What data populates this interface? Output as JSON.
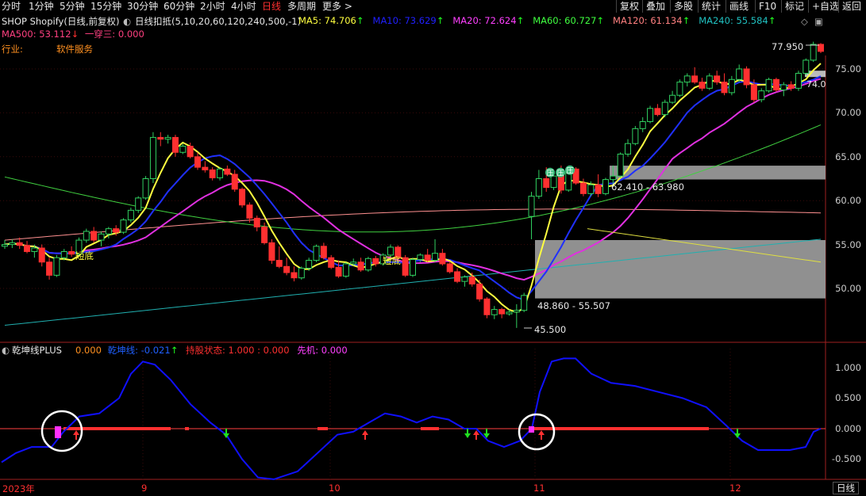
{
  "toolbar": {
    "periods": [
      "分时",
      "1分钟",
      "5分钟",
      "15分钟",
      "30分钟",
      "60分钟",
      "2小时",
      "4小时",
      "日线",
      "多周期",
      "更多 >"
    ],
    "active_period": "日线",
    "right_buttons": [
      "复权",
      "叠加",
      "多股",
      "统计",
      "画线",
      "F10",
      "标记",
      "+自选",
      "返回"
    ]
  },
  "header": {
    "stock": "SHOP Shopify(日线,前复权)",
    "indicator_name": "日线扣抵(5,10,20,60,120,240,500,-1)",
    "ma_values": [
      {
        "label": "MA5: 74.706",
        "arrow": "↑",
        "color": "#ffff40"
      },
      {
        "label": "MA10: 73.629",
        "arrow": "↑",
        "color": "#2020ff"
      },
      {
        "label": "MA20: 72.624",
        "arrow": "↑",
        "color": "#ff40ff"
      },
      {
        "label": "MA60: 60.727",
        "arrow": "↑",
        "color": "#40ff40"
      },
      {
        "label": "MA120: 61.134",
        "arrow": "↑",
        "color": "#ff8080"
      },
      {
        "label": "MA240: 55.584",
        "arrow": "↑",
        "color": "#20c0c0"
      }
    ],
    "ma500": {
      "label": "MA500: 53.112",
      "arrow": "↓",
      "color": "#ff4080"
    },
    "extra": {
      "label": "一穿三: 0.000",
      "color": "#ff4080"
    },
    "industry_label": "行业:",
    "industry_value": "软件服务"
  },
  "main_axis": {
    "labels": [
      "75.00",
      "70.00",
      "65.00",
      "60.00",
      "55.00",
      "50.00"
    ]
  },
  "annotations": {
    "high_price": "77.950",
    "low_price": "45.500",
    "zone_upper": "62.410 - 63.980",
    "zone_lower": "48.860 - 55.507",
    "short_bottom": "短底",
    "pressure": "压",
    "right_tag": "74.0"
  },
  "sub_panel": {
    "title": "乾坤线PLUS",
    "values": [
      {
        "label": "0.000",
        "color": "#ff9020"
      },
      {
        "label": "乾坤线: -0.021",
        "color": "#2060ff",
        "arrow": "↑",
        "arrow_color": "#20ff20"
      },
      {
        "label": "持股状态: 1.000 : 0.000",
        "color": "#ff3030"
      },
      {
        "label": "先机: 0.000",
        "color": "#ff40ff"
      }
    ],
    "axis_labels": [
      "1.000",
      "0.500",
      "0.000",
      "-0.500"
    ]
  },
  "x_axis": {
    "labels": [
      "2023年",
      "9",
      "10",
      "11",
      "12"
    ],
    "period_tag": "日线"
  },
  "colors": {
    "up": "#ff3030",
    "down": "#20d0d0",
    "ma5": "#ffff40",
    "ma10": "#2030ff",
    "ma20": "#e030e0",
    "ma60": "#40d040",
    "ma120": "#ff9090",
    "ma240": "#20b0b0",
    "zone": "#909090",
    "qiankun": "#1010ff"
  },
  "chart_data": {
    "type": "candlestick",
    "ylim": [
      44,
      79
    ],
    "candles": [
      [
        54.8,
        55.5,
        54.5,
        55.0
      ],
      [
        55.0,
        55.6,
        54.6,
        55.2
      ],
      [
        55.2,
        55.8,
        54.5,
        54.9
      ],
      [
        54.9,
        55.4,
        54.0,
        54.2
      ],
      [
        54.2,
        55.0,
        53.5,
        54.6
      ],
      [
        54.6,
        55.0,
        52.5,
        53.0
      ],
      [
        53.0,
        53.5,
        51.0,
        51.5
      ],
      [
        51.5,
        53.8,
        51.3,
        53.5
      ],
      [
        53.5,
        54.5,
        53.2,
        54.2
      ],
      [
        54.2,
        54.8,
        53.6,
        53.9
      ],
      [
        53.9,
        55.8,
        53.7,
        55.5
      ],
      [
        55.5,
        56.8,
        55.2,
        56.5
      ],
      [
        56.5,
        57.0,
        55.2,
        55.5
      ],
      [
        55.5,
        56.5,
        54.8,
        56.2
      ],
      [
        56.2,
        57.0,
        55.7,
        56.8
      ],
      [
        56.8,
        57.2,
        56.0,
        56.4
      ],
      [
        56.4,
        58.0,
        56.2,
        57.8
      ],
      [
        57.8,
        59.2,
        57.5,
        58.9
      ],
      [
        58.9,
        60.5,
        58.6,
        60.3
      ],
      [
        60.3,
        62.8,
        60.1,
        62.5
      ],
      [
        62.5,
        67.8,
        62.0,
        67.2
      ],
      [
        67.2,
        67.8,
        66.2,
        67.0
      ],
      [
        67.0,
        67.5,
        66.5,
        67.2
      ],
      [
        67.2,
        67.5,
        65.0,
        65.5
      ],
      [
        65.5,
        66.5,
        65.3,
        66.2
      ],
      [
        66.2,
        66.6,
        64.8,
        65.0
      ],
      [
        65.0,
        65.5,
        63.5,
        63.8
      ],
      [
        63.8,
        64.5,
        63.2,
        63.5
      ],
      [
        63.5,
        63.8,
        62.3,
        62.6
      ],
      [
        62.6,
        63.8,
        62.3,
        63.6
      ],
      [
        63.6,
        64.0,
        62.8,
        63.0
      ],
      [
        63.0,
        63.5,
        61.0,
        61.3
      ],
      [
        61.3,
        61.5,
        59.2,
        59.5
      ],
      [
        59.5,
        59.8,
        57.5,
        58.0
      ],
      [
        58.0,
        58.3,
        56.5,
        57.0
      ],
      [
        57.0,
        57.5,
        55.0,
        55.2
      ],
      [
        55.2,
        55.6,
        52.8,
        53.2
      ],
      [
        53.2,
        54.8,
        52.3,
        52.5
      ],
      [
        52.5,
        53.5,
        51.5,
        51.8
      ],
      [
        51.8,
        52.5,
        50.8,
        51.2
      ],
      [
        51.2,
        52.5,
        51.0,
        52.3
      ],
      [
        52.3,
        53.5,
        52.0,
        53.2
      ],
      [
        53.2,
        55.0,
        53.0,
        54.8
      ],
      [
        54.8,
        55.2,
        53.3,
        53.5
      ],
      [
        53.5,
        53.8,
        52.2,
        52.4
      ],
      [
        52.4,
        53.2,
        51.2,
        51.4
      ],
      [
        51.4,
        53.0,
        51.2,
        52.8
      ],
      [
        52.8,
        53.4,
        52.6,
        53.0
      ],
      [
        53.0,
        53.5,
        51.9,
        52.1
      ],
      [
        52.1,
        53.6,
        51.9,
        53.4
      ],
      [
        53.4,
        53.7,
        52.5,
        52.8
      ],
      [
        52.8,
        54.0,
        52.6,
        53.8
      ],
      [
        53.8,
        55.0,
        53.6,
        54.7
      ],
      [
        54.7,
        54.9,
        53.3,
        53.5
      ],
      [
        53.5,
        53.8,
        51.3,
        51.5
      ],
      [
        51.5,
        53.5,
        51.3,
        53.3
      ],
      [
        53.3,
        54.0,
        53.0,
        53.8
      ],
      [
        53.8,
        54.5,
        53.0,
        53.2
      ],
      [
        53.2,
        55.6,
        53.0,
        54.0
      ],
      [
        54.0,
        54.5,
        52.6,
        52.8
      ],
      [
        52.8,
        53.0,
        51.7,
        51.9
      ],
      [
        51.9,
        52.3,
        50.6,
        50.8
      ],
      [
        50.8,
        51.5,
        50.2,
        51.3
      ],
      [
        51.3,
        51.8,
        50.2,
        50.5
      ],
      [
        50.5,
        51.0,
        48.5,
        48.8
      ],
      [
        48.8,
        49.0,
        46.6,
        47.0
      ],
      [
        47.0,
        48.0,
        46.5,
        47.6
      ],
      [
        47.6,
        47.8,
        46.6,
        47.1
      ],
      [
        47.1,
        47.6,
        46.9,
        47.3
      ],
      [
        47.3,
        48.2,
        45.5,
        47.5
      ],
      [
        47.5,
        49.5,
        47.3,
        49.2
      ],
      [
        58.2,
        61.0,
        55.6,
        60.5
      ],
      [
        60.5,
        63.5,
        60.2,
        62.5
      ],
      [
        62.5,
        63.8,
        61.0,
        61.5
      ],
      [
        61.5,
        63.5,
        61.2,
        62.8
      ],
      [
        62.8,
        64.0,
        60.8,
        61.2
      ],
      [
        61.2,
        63.9,
        61.0,
        63.6
      ],
      [
        63.6,
        63.8,
        61.8,
        62.0
      ],
      [
        62.0,
        62.5,
        60.5,
        60.8
      ],
      [
        60.8,
        62.2,
        60.5,
        61.8
      ],
      [
        61.8,
        63.0,
        60.4,
        60.8
      ],
      [
        60.8,
        62.6,
        60.6,
        62.4
      ],
      [
        62.4,
        64.0,
        61.8,
        62.8
      ],
      [
        62.8,
        65.5,
        62.6,
        65.3
      ],
      [
        65.3,
        67.0,
        65.0,
        66.5
      ],
      [
        66.5,
        68.5,
        66.3,
        68.2
      ],
      [
        68.2,
        69.5,
        67.8,
        69.0
      ],
      [
        69.0,
        70.8,
        68.8,
        70.5
      ],
      [
        70.5,
        71.0,
        69.6,
        69.8
      ],
      [
        69.8,
        71.5,
        69.5,
        71.2
      ],
      [
        71.2,
        72.5,
        71.0,
        72.0
      ],
      [
        72.0,
        73.8,
        71.8,
        73.5
      ],
      [
        73.5,
        74.5,
        73.0,
        74.2
      ],
      [
        74.2,
        75.2,
        73.3,
        73.5
      ],
      [
        73.5,
        74.0,
        72.5,
        72.8
      ],
      [
        72.8,
        74.5,
        72.6,
        74.2
      ],
      [
        74.2,
        74.8,
        73.2,
        73.5
      ],
      [
        73.5,
        74.5,
        72.0,
        72.3
      ],
      [
        72.3,
        74.2,
        72.0,
        73.8
      ],
      [
        73.8,
        75.5,
        73.5,
        75.0
      ],
      [
        75.0,
        75.3,
        72.8,
        73.2
      ],
      [
        73.2,
        73.8,
        71.2,
        71.5
      ],
      [
        71.5,
        72.8,
        71.2,
        72.5
      ],
      [
        72.5,
        74.0,
        72.3,
        73.8
      ],
      [
        73.8,
        74.0,
        72.4,
        72.6
      ],
      [
        72.6,
        73.5,
        71.9,
        73.2
      ],
      [
        73.2,
        73.6,
        72.5,
        72.8
      ],
      [
        72.8,
        74.8,
        72.5,
        74.5
      ],
      [
        74.5,
        76.2,
        74.3,
        76.0
      ],
      [
        76.0,
        78.1,
        75.8,
        77.8
      ],
      [
        77.8,
        77.95,
        76.8,
        77.0
      ]
    ]
  }
}
